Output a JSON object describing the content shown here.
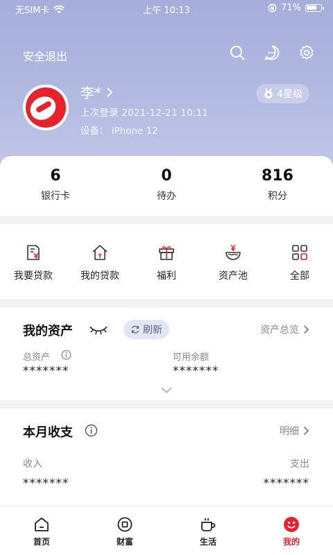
{
  "status_bar": {
    "carrier": "无SIM卡",
    "time": "上午 10:13",
    "battery": "71%"
  },
  "header": {
    "logout_label": "安全退出",
    "username": "李*",
    "last_login": "上次登录 2021-12-21 10:11",
    "device": "设备：  iPhone 12",
    "star_level": "4星级"
  },
  "stats": [
    {
      "value": "6",
      "label": "银行卡"
    },
    {
      "value": "0",
      "label": "待办"
    },
    {
      "value": "816",
      "label": "积分"
    }
  ],
  "quick_actions": [
    {
      "label": "我要贷款",
      "icon": "loan-apply-icon"
    },
    {
      "label": "我的贷款",
      "icon": "house-icon"
    },
    {
      "label": "福利",
      "icon": "gift-icon"
    },
    {
      "label": "资产池",
      "icon": "asset-pool-icon"
    },
    {
      "label": "全部",
      "icon": "grid-icon"
    }
  ],
  "assets": {
    "title": "我的资产",
    "refresh_label": "刷新",
    "overview_label": "资产总览",
    "total_label": "总资产",
    "total_value": "*******",
    "available_label": "可用余额",
    "available_value": "*******"
  },
  "monthly": {
    "title": "本月收支",
    "detail_label": "明细",
    "income_label": "收入",
    "income_value": "*******",
    "expense_label": "支出",
    "expense_value": "*******"
  },
  "tabs": [
    {
      "label": "首页"
    },
    {
      "label": "财富"
    },
    {
      "label": "生活"
    },
    {
      "label": "我的"
    }
  ],
  "colors": {
    "accent": "#e8222c",
    "header_bg": "#a9b1db"
  }
}
